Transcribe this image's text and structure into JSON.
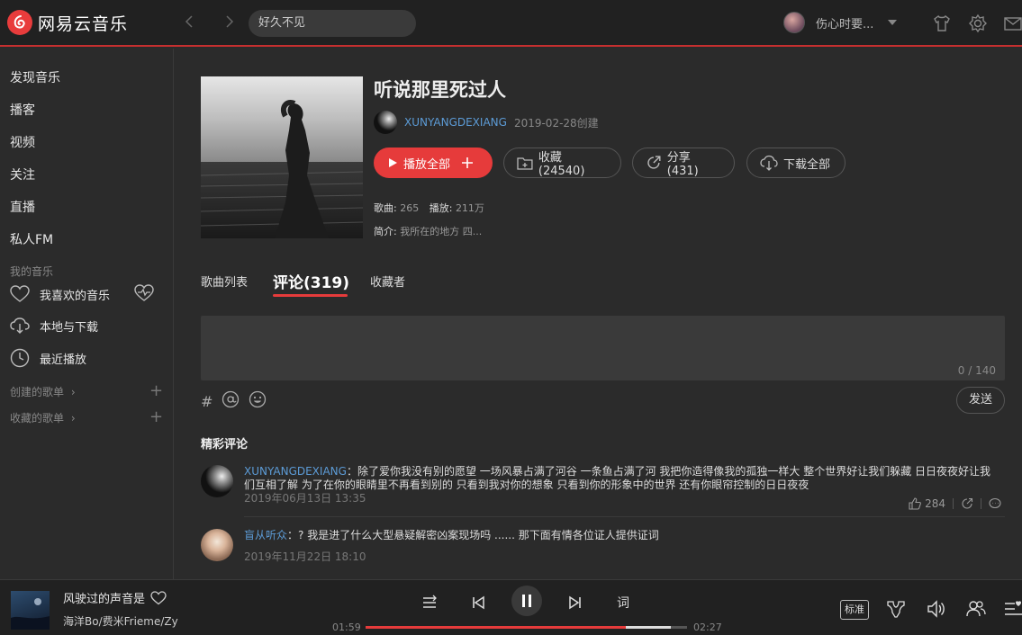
{
  "app": {
    "logo_text": "网易云音乐",
    "search_value": "好久不见",
    "username": "伤心时要..."
  },
  "sidebar": {
    "items": [
      {
        "label": "发现音乐"
      },
      {
        "label": "播客"
      },
      {
        "label": "视频"
      },
      {
        "label": "关注"
      },
      {
        "label": "直播"
      },
      {
        "label": "私人FM"
      }
    ],
    "my_music_label": "我的音乐",
    "my_music": [
      {
        "label": "我喜欢的音乐",
        "icon": "heart-icon"
      },
      {
        "label": "本地与下载",
        "icon": "download-icon"
      },
      {
        "label": "最近播放",
        "icon": "clock-icon"
      }
    ],
    "created_playlists": "创建的歌单",
    "collected_playlists": "收藏的歌单"
  },
  "playlist": {
    "title": "听说那里死过人",
    "creator": "XUNYANGDEXIANG",
    "created_date": "2019-02-28创建",
    "play_all_label": "播放全部",
    "collect_label": "收藏(24540)",
    "share_label": "分享(431)",
    "download_label": "下载全部",
    "songs_label": "歌曲:",
    "songs_value": "265",
    "plays_label": "播放:",
    "plays_value": "211万",
    "intro_label": "简介:",
    "intro_value": "我所在的地方 四..."
  },
  "tabs": [
    {
      "label": "歌曲列表"
    },
    {
      "label": "评论(319)"
    },
    {
      "label": "收藏者"
    }
  ],
  "comment_input": {
    "counter": "0 / 140",
    "send_label": "发送"
  },
  "comments_section_title": "精彩评论",
  "comments": [
    {
      "user": "XUNYANGDEXIANG",
      "text": "：除了爱你我没有别的愿望 一场风暴占满了河谷 一条鱼占满了河 我把你造得像我的孤独一样大 整个世界好让我们躲藏 日日夜夜好让我们互相了解 为了在你的眼睛里不再看到别的 只看到我对你的想象 只看到你的形象中的世界 还有你眼帘控制的日日夜夜",
      "time": "2019年06月13日 13:35",
      "likes": "284"
    },
    {
      "user": "盲从听众",
      "text": "：? 我是进了什么大型悬疑解密凶案现场吗 ...... 那下面有情各位证人提供证词",
      "time": "2019年11月22日 18:10"
    }
  ],
  "player": {
    "song_title": "风驶过的声音是",
    "artist": "海洋Bo/费米Frieme/Zy",
    "current_time": "01:59",
    "total_time": "02:27",
    "progress": 0.81,
    "buffered": 0.95,
    "lyric_label": "词",
    "quality_label": "标准"
  },
  "colors": {
    "accent": "#e63b3b",
    "link": "#5c9bd6",
    "background": "#2b2b2b",
    "topbar": "#212121"
  }
}
